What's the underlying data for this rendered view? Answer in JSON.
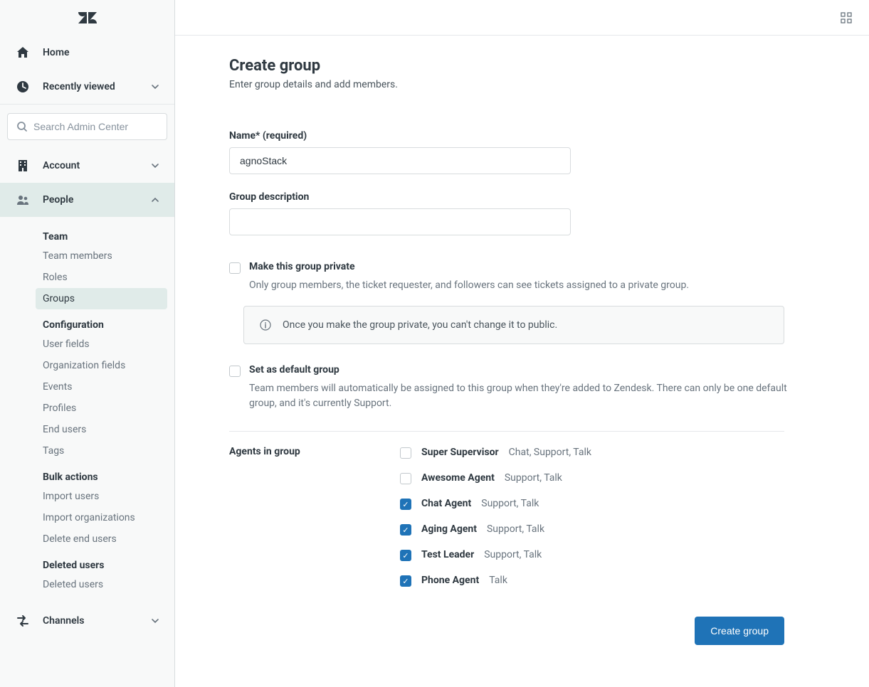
{
  "sidebar": {
    "home_label": "Home",
    "recently_viewed_label": "Recently viewed",
    "search_placeholder": "Search Admin Center",
    "account_label": "Account",
    "people_label": "People",
    "channels_label": "Channels",
    "people_sections": [
      {
        "heading": "Team",
        "items": [
          "Team members",
          "Roles",
          "Groups"
        ]
      },
      {
        "heading": "Configuration",
        "items": [
          "User fields",
          "Organization fields",
          "Events",
          "Profiles",
          "End users",
          "Tags"
        ]
      },
      {
        "heading": "Bulk actions",
        "items": [
          "Import users",
          "Import organizations",
          "Delete end users"
        ]
      },
      {
        "heading": "Deleted users",
        "items": [
          "Deleted users"
        ]
      }
    ],
    "selected_item": "Groups"
  },
  "page": {
    "title": "Create group",
    "subtitle": "Enter group details and add members."
  },
  "form": {
    "name_label": "Name* (required)",
    "name_value": "agnoStack",
    "description_label": "Group description",
    "description_value": "",
    "private_label": "Make this group private",
    "private_desc": "Only group members, the ticket requester, and followers can see tickets assigned to a private group.",
    "private_info": "Once you make the group private, you can't change it to public.",
    "default_label": "Set as default group",
    "default_desc": "Team members will automatically be assigned to this group when they're added to Zendesk. There can only be one default group, and it's currently Support.",
    "agents_label": "Agents in group",
    "agents": [
      {
        "name": "Super Supervisor",
        "products": "Chat, Support, Talk",
        "checked": false
      },
      {
        "name": "Awesome Agent",
        "products": "Support, Talk",
        "checked": false
      },
      {
        "name": "Chat Agent",
        "products": "Support, Talk",
        "checked": true
      },
      {
        "name": "Aging Agent",
        "products": "Support, Talk",
        "checked": true
      },
      {
        "name": "Test Leader",
        "products": "Support, Talk",
        "checked": true
      },
      {
        "name": "Phone Agent",
        "products": "Talk",
        "checked": true
      }
    ],
    "submit_label": "Create group"
  },
  "colors": {
    "primary": "#1f73b7",
    "sidebar_bg": "#f8f9f9",
    "text": "#2f3941",
    "muted": "#68737d"
  }
}
